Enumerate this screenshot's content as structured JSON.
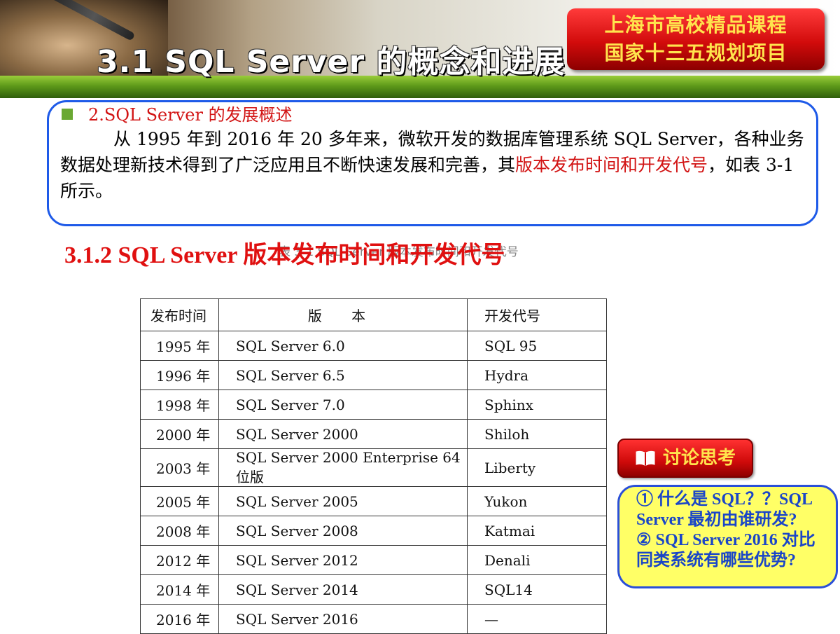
{
  "header": {
    "title": "3.1 SQL Server 的概念和进展",
    "badge_line1": "上海市高校精品课程",
    "badge_line2": "国家十三五规划项目"
  },
  "intro": {
    "heading": "2.SQL Server 的发展概述",
    "text_part1": "从 1995 年到 2016 年 20 多年来，微软开发的数据库管理系统 SQL Server，各种业务数据处理新技术得到了广泛应用且不断快速发展和完善，其",
    "text_highlight": "版本发布时间和开发代号",
    "text_part2": "，如表 3-1 所示。"
  },
  "section": {
    "title": "3.1.2 SQL Server 版本发布时间和开发代号",
    "overlap_caption": "表 3-1 SQL Server 版本发布时间和开发代号"
  },
  "table": {
    "headers": [
      "发布时间",
      "版 本",
      "开发代号"
    ],
    "rows": [
      [
        "1995 年",
        "SQL Server 6.0",
        "SQL 95"
      ],
      [
        "1996 年",
        "SQL Server 6.5",
        "Hydra"
      ],
      [
        "1998 年",
        "SQL Server 7.0",
        "Sphinx"
      ],
      [
        "2000 年",
        "SQL Server 2000",
        "Shiloh"
      ],
      [
        "2003 年",
        "SQL Server 2000 Enterprise 64 位版",
        "Liberty"
      ],
      [
        "2005 年",
        "SQL Server 2005",
        "Yukon"
      ],
      [
        "2008 年",
        "SQL Server 2008",
        "Katmai"
      ],
      [
        "2012 年",
        "SQL Server 2012",
        "Denali"
      ],
      [
        "2014 年",
        "SQL Server 2014",
        "SQL14"
      ],
      [
        "2016 年",
        "SQL Server 2016",
        "—"
      ]
    ]
  },
  "discussion": {
    "button_label": "讨论思考",
    "q1": "① 什么是 SQL？？SQL Server 最初由谁研发?",
    "q2": "② SQL Server 2016 对比同类系统有哪些优势?"
  },
  "colors": {
    "accent_red": "#d21414",
    "badge_text": "#ffe44d",
    "box_border": "#1e5ae8",
    "question_bg": "#ffff66"
  }
}
